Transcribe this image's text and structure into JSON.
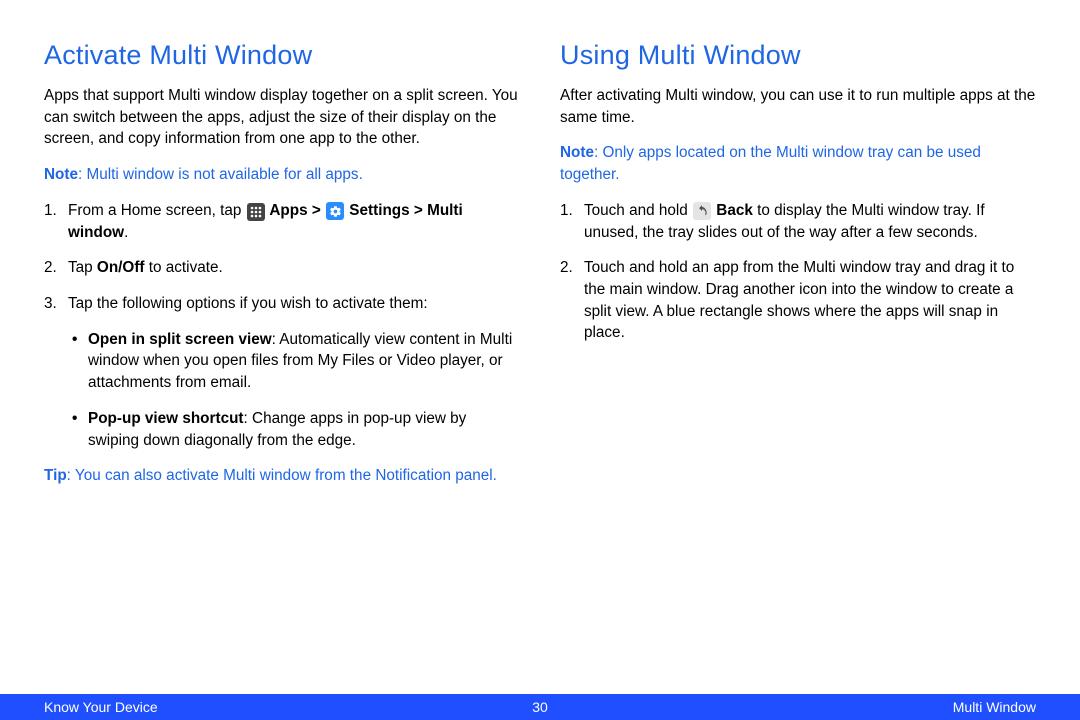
{
  "left": {
    "heading": "Activate Multi Window",
    "intro": "Apps that support Multi window display together on a split screen. You can switch between the apps, adjust the size of their display on the screen, and copy information from one app to the other.",
    "note_label": "Note",
    "note_text": ": Multi window is not available for all apps.",
    "step1_a": "From a Home screen, tap ",
    "step1_apps": " Apps > ",
    "step1_settings": " Settings > Multi window",
    "step1_end": ".",
    "step2_a": "Tap ",
    "step2_b": "On/Off",
    "step2_c": " to activate.",
    "step3": "Tap the following options if you wish to activate them:",
    "bullet1_a": "Open in split screen view",
    "bullet1_b": ": Automatically view content in Multi window when you open files from My Files or Video player, or attachments from email.",
    "bullet2_a": "Pop-up view shortcut",
    "bullet2_b": ": Change apps in pop-up view by swiping down diagonally from the edge.",
    "tip_label": "Tip",
    "tip_text": ": You can also activate Multi window from the Notification panel."
  },
  "right": {
    "heading": "Using Multi Window",
    "intro": "After activating Multi window, you can use it to run multiple apps at the same time.",
    "note_label": "Note",
    "note_text": ": Only apps located on the Multi window tray can be used together.",
    "step1_a": "Touch and hold ",
    "step1_b": " Back",
    "step1_c": " to display the Multi window tray. If unused, the tray slides out of the way after a few seconds.",
    "step2": "Touch and hold an app from the Multi window tray and drag it to the main window. Drag another icon into the window to create a split view. A blue rectangle shows where the apps will snap in place."
  },
  "footer": {
    "left": "Know Your Device",
    "center": "30",
    "right": "Multi Window"
  }
}
